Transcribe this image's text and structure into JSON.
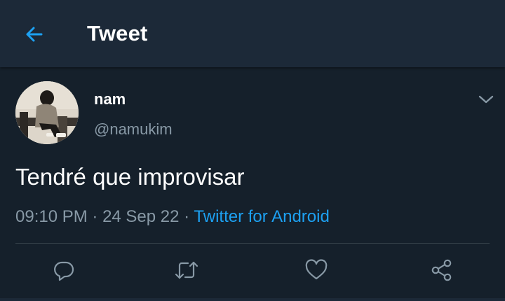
{
  "colors": {
    "background": "#15202b",
    "header_background": "#1c2938",
    "accent": "#1da1f2",
    "secondary_text": "#8899a6",
    "divider": "#38444d"
  },
  "header": {
    "back_icon": "arrow-left-icon",
    "title": "Tweet"
  },
  "tweet": {
    "author": {
      "name": "nam",
      "handle": "@namukim",
      "avatar": "profile-photo"
    },
    "more_icon": "chevron-down-icon",
    "text": "Tendré que improvisar",
    "time": "09:10 PM",
    "separator": " · ",
    "date": "24 Sep 22",
    "source": "Twitter for Android"
  },
  "actions": [
    {
      "name": "reply",
      "icon": "reply-icon"
    },
    {
      "name": "retweet",
      "icon": "retweet-icon"
    },
    {
      "name": "like",
      "icon": "heart-icon"
    },
    {
      "name": "share",
      "icon": "share-icon"
    }
  ]
}
